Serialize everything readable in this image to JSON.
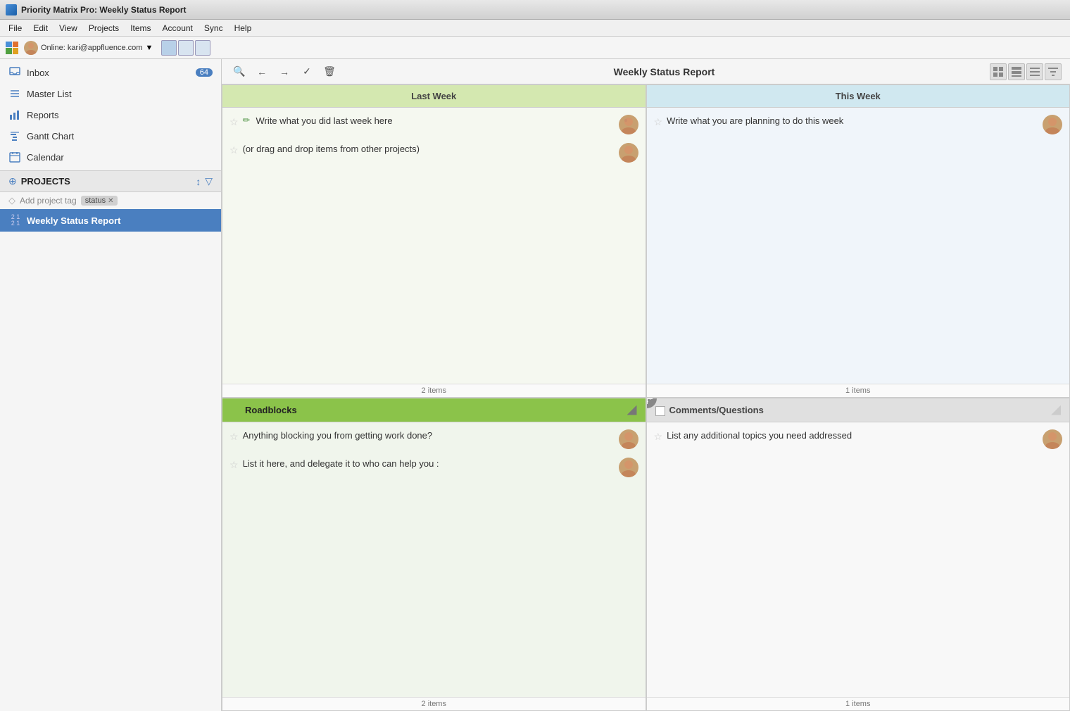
{
  "titleBar": {
    "title": "Priority Matrix Pro: Weekly Status Report",
    "icon": "pm-icon"
  },
  "menuBar": {
    "items": [
      "File",
      "Edit",
      "View",
      "Projects",
      "Items",
      "Account",
      "Sync",
      "Help"
    ]
  },
  "toolbar": {
    "user": "Online: kari@appfluence.com",
    "dropdown": "▼"
  },
  "contentToolbar": {
    "title": "Weekly Status Report",
    "buttons": [
      "zoom-in",
      "back",
      "forward",
      "check",
      "delete"
    ],
    "viewButtons": [
      "grid-view",
      "list-view-1",
      "list-view-2",
      "filter-view"
    ]
  },
  "sidebar": {
    "navItems": [
      {
        "id": "inbox",
        "label": "Inbox",
        "badge": "64",
        "icon": "□"
      },
      {
        "id": "master-list",
        "label": "Master List",
        "icon": "≡"
      },
      {
        "id": "reports",
        "label": "Reports",
        "icon": "📊"
      },
      {
        "id": "gantt",
        "label": "Gantt Chart",
        "icon": "📅"
      },
      {
        "id": "calendar",
        "label": "Calendar",
        "icon": "📆"
      }
    ],
    "projects": {
      "label": "PROJECTS",
      "addTagPlaceholder": "Add project tag",
      "currentTag": "status",
      "items": [
        {
          "id": "weekly-status",
          "label": "Weekly Status Report",
          "numbers": "2 1",
          "active": true
        }
      ]
    }
  },
  "quadrants": {
    "topLeft": {
      "header": "Last Week",
      "headerClass": "green",
      "bodyClass": "",
      "items": [
        {
          "text": "Write what you did last week here",
          "hasAvatar": true,
          "hasPencil": true
        },
        {
          "text": "(or drag and drop items from other projects)",
          "hasAvatar": true
        }
      ],
      "footer": "2 items"
    },
    "topRight": {
      "header": "This Week",
      "headerClass": "blue",
      "bodyClass": "light-blue",
      "items": [
        {
          "text": "Write what you are planning to do this week",
          "hasAvatar": true
        }
      ],
      "footer": "1 items"
    },
    "bottomLeft": {
      "header": "Roadblocks",
      "headerClass": "green-dark",
      "bodyClass": "light-green2",
      "items": [
        {
          "text": "Anything blocking you from getting work done?",
          "hasAvatar": true
        },
        {
          "text": "List it here, and delegate it to who can help you :",
          "hasAvatar": true
        }
      ],
      "footer": "2 items"
    },
    "bottomRight": {
      "header": "Comments/Questions",
      "headerClass": "gray",
      "bodyClass": "light-gray",
      "items": [
        {
          "text": "List any additional topics you need addressed",
          "hasAvatar": true
        }
      ],
      "footer": "1 items"
    }
  }
}
